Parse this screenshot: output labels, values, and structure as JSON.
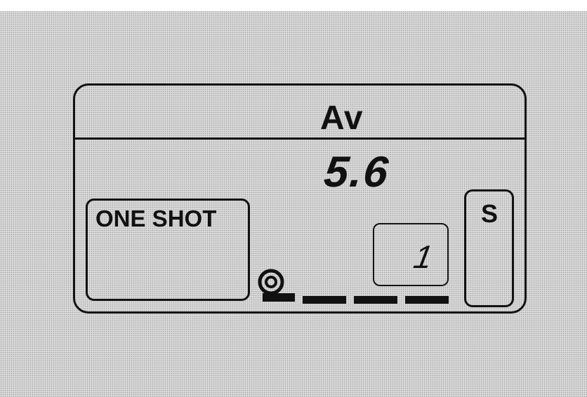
{
  "display": {
    "mode": "Av",
    "aperture": "5.6",
    "af_mode": "ONE SHOT",
    "frame_counter": "1",
    "drive_mode": "S",
    "film_progress_bars": 3
  },
  "icons": {
    "film_cartridge": "film-cartridge-icon"
  },
  "colors": {
    "background": "#d4d4d4",
    "ink": "#111111"
  }
}
